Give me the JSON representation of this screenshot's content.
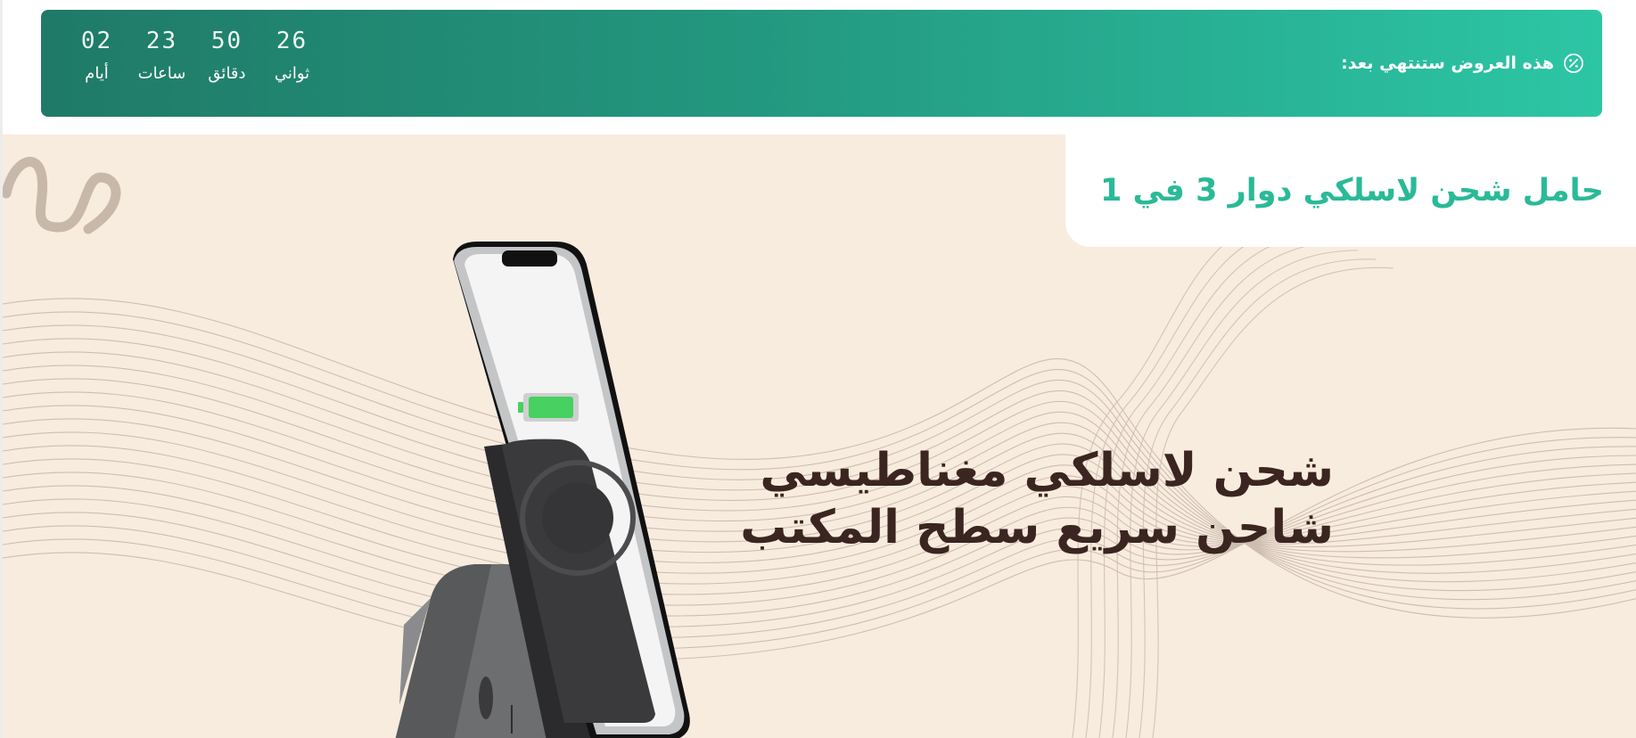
{
  "offer_bar": {
    "label": "هذه العروض ستنتهي بعد:",
    "icon": "discount-badge-icon",
    "countdown": [
      {
        "value": "02",
        "unit": "أيام"
      },
      {
        "value": "23",
        "unit": "ساعات"
      },
      {
        "value": "50",
        "unit": "دقائق"
      },
      {
        "value": "26",
        "unit": "ثواني"
      }
    ]
  },
  "hero": {
    "product_title": "حامل شحن لاسلكي دوار 3 في 1",
    "headline_line1": "شحن لاسلكي مغناطيسي",
    "headline_line2": "شاحن سريع سطح المكتب",
    "image": "wireless-charging-stand-with-phone",
    "decoration": "squiggle-decoration"
  },
  "colors": {
    "banner_start": "#1f7a67",
    "banner_end": "#2cc6a5",
    "accent": "#2aba98",
    "hero_bg": "#f8ecdf",
    "headline": "#3b2520"
  }
}
